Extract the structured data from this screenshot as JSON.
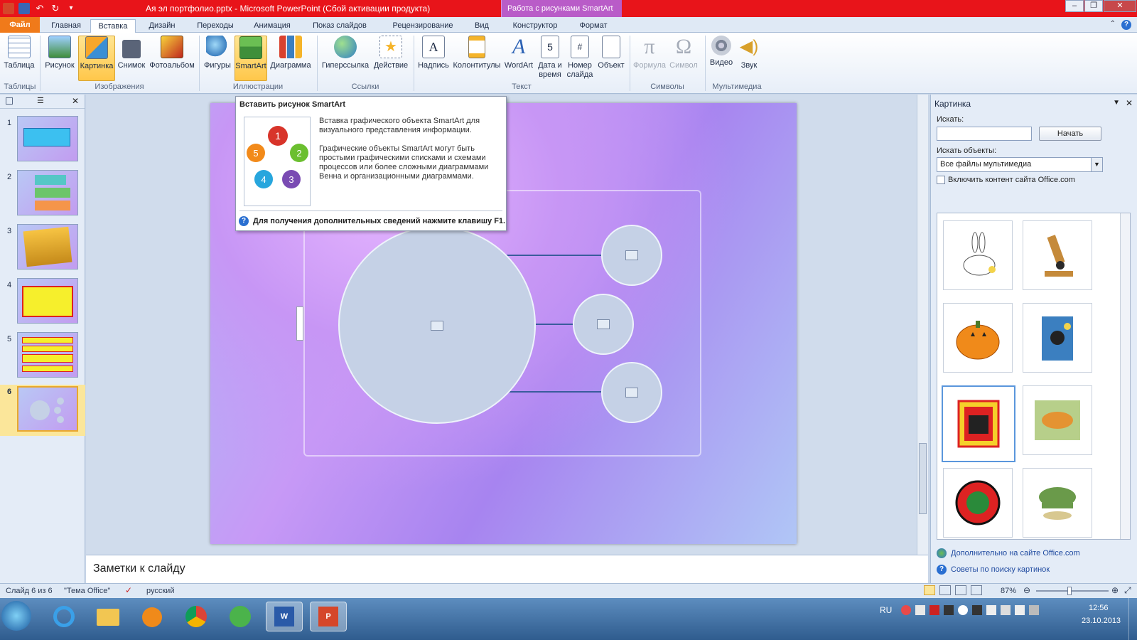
{
  "titlebar": {
    "title": "Ая эл портфолио.pptx  -  Microsoft PowerPoint (Сбой активации продукта)",
    "context_tab": "Работа с рисунками SmartArt"
  },
  "tabs": [
    "Файл",
    "Главная",
    "Вставка",
    "Дизайн",
    "Переходы",
    "Анимация",
    "Показ слайдов",
    "Рецензирование",
    "Вид",
    "Конструктор",
    "Формат"
  ],
  "ribbon": {
    "buttons": [
      "Таблица",
      "Рисунок",
      "Картинка",
      "Снимок",
      "Фотоальбом",
      "Фигуры",
      "SmartArt",
      "Диаграмма",
      "Гиперссылка",
      "Действие",
      "Надпись",
      "Колонтитулы",
      "WordArt",
      "Дата и время",
      "Номер слайда",
      "Объект",
      "Формула",
      "Символ",
      "Видео",
      "Звук"
    ],
    "groups": [
      "Таблицы",
      "Изображения",
      "Иллюстрации",
      "Ссылки",
      "Текст",
      "Символы",
      "Мультимедиа"
    ]
  },
  "tooltip": {
    "title": "Вставить рисунок SmartArt",
    "p1": "Вставка графического объекта SmartArt для визуального представления информации.",
    "p2": "Графические объекты SmartArt могут быть простыми графическими списками и схемами процессов или более сложными диаграммами Венна и организационными диаграммами.",
    "footer": "Для получения дополнительных сведений нажмите клавишу F1.",
    "numbers": [
      "1",
      "2",
      "3",
      "4",
      "5"
    ]
  },
  "slides": [
    "1",
    "2",
    "3",
    "4",
    "5",
    "6"
  ],
  "clippane": {
    "title": "Картинка",
    "search_label": "Искать:",
    "search_value": "",
    "start_button": "Начать",
    "objects_label": "Искать объекты:",
    "objects_value": "Все файлы мультимедиа",
    "include_office": "Включить контент сайта Office.com",
    "more_link": "Дополнительно на сайте Office.com",
    "tips_link": "Советы по поиску картинок"
  },
  "notes": {
    "placeholder": "Заметки к слайду"
  },
  "status": {
    "slide": "Слайд 6 из 6",
    "theme": "\"Тема Office\"",
    "lang": "русский",
    "zoom": "87%"
  },
  "taskbar": {
    "lang": "RU",
    "time": "12:56",
    "date": "23.10.2013"
  },
  "colors": {
    "titlebar": "#e8141a",
    "file_tab": "#f07a1a",
    "context_tab": "#b95cc8"
  }
}
